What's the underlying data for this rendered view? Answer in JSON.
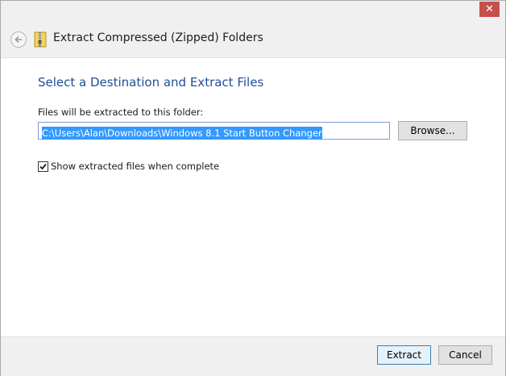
{
  "titlebar": {
    "title": "Extract Compressed (Zipped) Folders",
    "close_icon": "close-icon",
    "back_icon": "back-arrow-icon",
    "app_icon": "zip-folder-icon"
  },
  "main": {
    "heading": "Select a Destination and Extract Files",
    "field_label": "Files will be extracted to this folder:",
    "path_value": "C:\\Users\\Alan\\Downloads\\Windows 8.1 Start Button Changer",
    "browse_label": "Browse...",
    "show_files_checked": true,
    "show_files_label": "Show extracted files when complete"
  },
  "footer": {
    "extract_label": "Extract",
    "cancel_label": "Cancel"
  },
  "colors": {
    "accent_heading": "#1e4e98",
    "selection": "#3399ff",
    "close_button": "#c7504a"
  }
}
